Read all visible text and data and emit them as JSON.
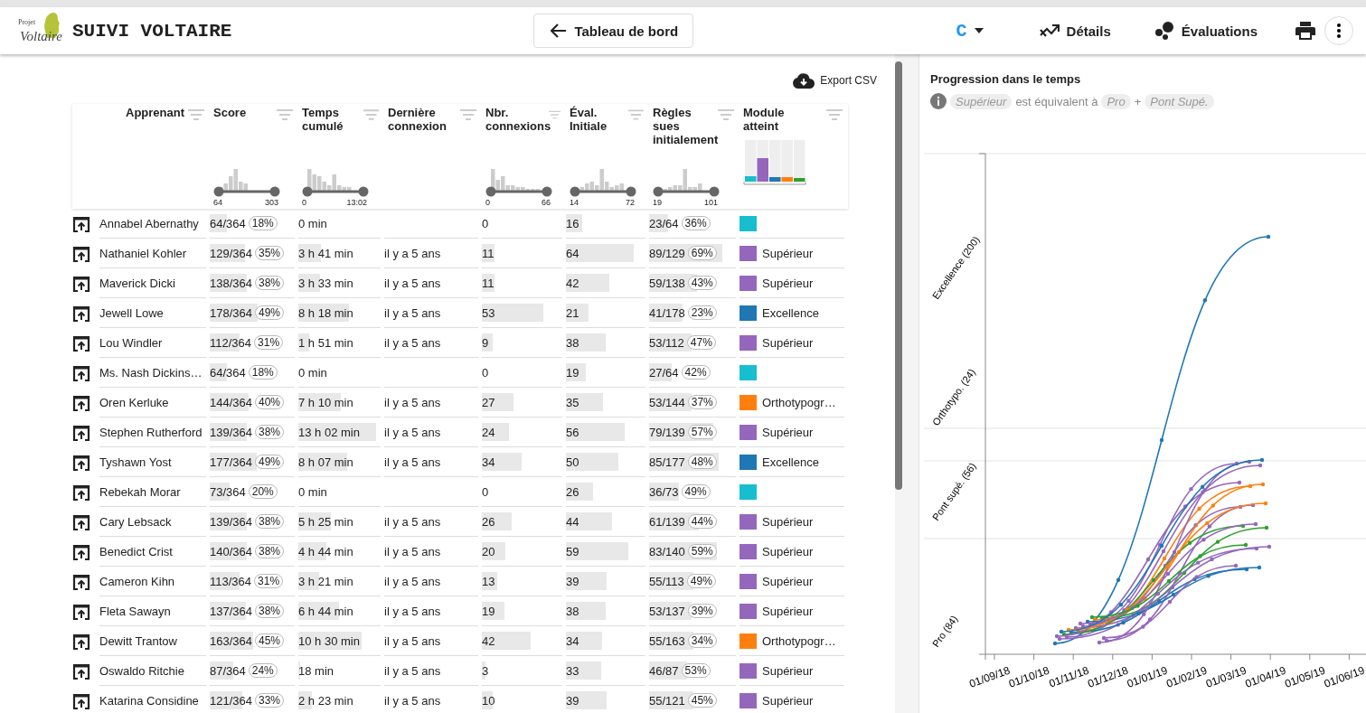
{
  "app_bar": {
    "logo_small": "Projet",
    "logo_script": "Voltaire",
    "title": "SUIVI VOLTAIRE",
    "back_button": "Tableau de bord",
    "level_menu": "C",
    "actions": [
      "Détails",
      "Évaluations"
    ]
  },
  "export_button": "Export CSV",
  "table": {
    "columns": [
      {
        "label": "Apprenant",
        "kind": "plain"
      },
      {
        "label": "Score",
        "kind": "histogram",
        "min": "64",
        "max": "303"
      },
      {
        "label": "Temps cumulé",
        "kind": "histogram",
        "min": "0",
        "max": "13:02"
      },
      {
        "label": "Dernière connexion",
        "kind": "plain"
      },
      {
        "label": "Nbr. connexions",
        "kind": "histogram",
        "min": "0",
        "max": "66"
      },
      {
        "label": "Éval. Initiale",
        "kind": "histogram",
        "min": "14",
        "max": "72"
      },
      {
        "label": "Règles sues initialement",
        "kind": "histogram",
        "min": "19",
        "max": "101"
      },
      {
        "label": "Module atteint",
        "kind": "modules"
      }
    ],
    "rows": [
      {
        "name": "Annabel Abernathy",
        "score": {
          "text": "64/364",
          "pct": "18%",
          "level": 0.21
        },
        "time": {
          "text": "0 min"
        },
        "conn": {
          "text": "0"
        },
        "eval": {
          "text": "16",
          "level": 0.22
        },
        "rules": {
          "text": "23/64",
          "pct": "36%",
          "level": 0.23
        },
        "module": {
          "color": "#17becf"
        }
      },
      {
        "name": "Nathaniel Kohler",
        "score": {
          "text": "129/364",
          "pct": "35%",
          "level": 0.43
        },
        "time": {
          "text": "3 h 41 min",
          "level": 0.28
        },
        "last": "il y a 5 ans",
        "conn": {
          "text": "11",
          "level": 0.17
        },
        "eval": {
          "text": "64",
          "level": 0.89
        },
        "rules": {
          "text": "89/129",
          "pct": "69%",
          "level": 0.88
        },
        "module": {
          "color": "#9467bd",
          "label": "Supérieur"
        }
      },
      {
        "name": "Maverick Dicki",
        "score": {
          "text": "138/364",
          "pct": "38%",
          "level": 0.46
        },
        "time": {
          "text": "3 h 33 min",
          "level": 0.27
        },
        "last": "il y a 5 ans",
        "conn": {
          "text": "11",
          "level": 0.17
        },
        "eval": {
          "text": "42",
          "level": 0.58
        },
        "rules": {
          "text": "59/138",
          "pct": "43%",
          "level": 0.58
        },
        "module": {
          "color": "#9467bd",
          "label": "Supérieur"
        }
      },
      {
        "name": "Jewell Lowe",
        "score": {
          "text": "178/364",
          "pct": "49%",
          "level": 0.59
        },
        "time": {
          "text": "8 h 18 min",
          "level": 0.64
        },
        "last": "il y a 5 ans",
        "conn": {
          "text": "53",
          "level": 0.8
        },
        "eval": {
          "text": "21",
          "level": 0.29
        },
        "rules": {
          "text": "41/178",
          "pct": "23%",
          "level": 0.41
        },
        "module": {
          "color": "#1f77b4",
          "label": "Excellence"
        }
      },
      {
        "name": "Lou Windler",
        "score": {
          "text": "112/364",
          "pct": "31%",
          "level": 0.37
        },
        "time": {
          "text": "1 h 51 min",
          "level": 0.14
        },
        "last": "il y a 5 ans",
        "conn": {
          "text": "9",
          "level": 0.14
        },
        "eval": {
          "text": "38",
          "level": 0.53
        },
        "rules": {
          "text": "53/112",
          "pct": "47%",
          "level": 0.52
        },
        "module": {
          "color": "#9467bd",
          "label": "Supérieur"
        }
      },
      {
        "name": "Ms. Nash Dickins…",
        "score": {
          "text": "64/364",
          "pct": "18%",
          "level": 0.21
        },
        "time": {
          "text": "0 min"
        },
        "conn": {
          "text": "0"
        },
        "eval": {
          "text": "19",
          "level": 0.26
        },
        "rules": {
          "text": "27/64",
          "pct": "42%",
          "level": 0.27
        },
        "module": {
          "color": "#17becf"
        }
      },
      {
        "name": "Oren Kerluke",
        "score": {
          "text": "144/364",
          "pct": "40%",
          "level": 0.48
        },
        "time": {
          "text": "7 h 10 min",
          "level": 0.55
        },
        "last": "il y a 5 ans",
        "conn": {
          "text": "27",
          "level": 0.41
        },
        "eval": {
          "text": "35",
          "level": 0.49
        },
        "rules": {
          "text": "53/144",
          "pct": "37%",
          "level": 0.52
        },
        "module": {
          "color": "#ff7f0e",
          "label": "Orthotypogr…"
        }
      },
      {
        "name": "Stephen Rutherford",
        "score": {
          "text": "139/364",
          "pct": "38%",
          "level": 0.46
        },
        "time": {
          "text": "13 h 02 min",
          "level": 1
        },
        "last": "il y a 5 ans",
        "conn": {
          "text": "24",
          "level": 0.36
        },
        "eval": {
          "text": "56",
          "level": 0.78
        },
        "rules": {
          "text": "79/139",
          "pct": "57%",
          "level": 0.78
        },
        "module": {
          "color": "#9467bd",
          "label": "Supérieur"
        }
      },
      {
        "name": "Tyshawn Yost",
        "score": {
          "text": "177/364",
          "pct": "49%",
          "level": 0.58
        },
        "time": {
          "text": "8 h 07 min",
          "level": 0.62
        },
        "last": "il y a 5 ans",
        "conn": {
          "text": "34",
          "level": 0.52
        },
        "eval": {
          "text": "50",
          "level": 0.69
        },
        "rules": {
          "text": "85/177",
          "pct": "48%",
          "level": 0.84
        },
        "module": {
          "color": "#1f77b4",
          "label": "Excellence"
        }
      },
      {
        "name": "Rebekah Morar",
        "score": {
          "text": "73/364",
          "pct": "20%",
          "level": 0.24
        },
        "time": {
          "text": "0 min"
        },
        "conn": {
          "text": "0"
        },
        "eval": {
          "text": "26",
          "level": 0.36
        },
        "rules": {
          "text": "36/73",
          "pct": "49%",
          "level": 0.36
        },
        "module": {
          "color": "#17becf"
        }
      },
      {
        "name": "Cary Lebsack",
        "score": {
          "text": "139/364",
          "pct": "38%",
          "level": 0.46
        },
        "time": {
          "text": "5 h 25 min",
          "level": 0.42
        },
        "last": "il y a 5 ans",
        "conn": {
          "text": "26",
          "level": 0.39
        },
        "eval": {
          "text": "44",
          "level": 0.61
        },
        "rules": {
          "text": "61/139",
          "pct": "44%",
          "level": 0.6
        },
        "module": {
          "color": "#9467bd",
          "label": "Supérieur"
        }
      },
      {
        "name": "Benedict Crist",
        "score": {
          "text": "140/364",
          "pct": "38%",
          "level": 0.46
        },
        "time": {
          "text": "4 h 44 min",
          "level": 0.36
        },
        "last": "il y a 5 ans",
        "conn": {
          "text": "20",
          "level": 0.3
        },
        "eval": {
          "text": "59",
          "level": 0.82
        },
        "rules": {
          "text": "83/140",
          "pct": "59%",
          "level": 0.82
        },
        "module": {
          "color": "#9467bd",
          "label": "Supérieur"
        }
      },
      {
        "name": "Cameron Kihn",
        "score": {
          "text": "113/364",
          "pct": "31%",
          "level": 0.37
        },
        "time": {
          "text": "3 h 21 min",
          "level": 0.26
        },
        "last": "il y a 5 ans",
        "conn": {
          "text": "13",
          "level": 0.2
        },
        "eval": {
          "text": "39",
          "level": 0.54
        },
        "rules": {
          "text": "55/113",
          "pct": "49%",
          "level": 0.54
        },
        "module": {
          "color": "#9467bd",
          "label": "Supérieur"
        }
      },
      {
        "name": "Fleta Sawayn",
        "score": {
          "text": "137/364",
          "pct": "38%",
          "level": 0.45
        },
        "time": {
          "text": "6 h 44 min",
          "level": 0.52
        },
        "last": "il y a 5 ans",
        "conn": {
          "text": "19",
          "level": 0.29
        },
        "eval": {
          "text": "38",
          "level": 0.53
        },
        "rules": {
          "text": "53/137",
          "pct": "39%",
          "level": 0.52
        },
        "module": {
          "color": "#9467bd",
          "label": "Supérieur"
        }
      },
      {
        "name": "Dewitt Trantow",
        "score": {
          "text": "163/364",
          "pct": "45%",
          "level": 0.54
        },
        "time": {
          "text": "10 h 30 min",
          "level": 0.81
        },
        "last": "il y a 5 ans",
        "conn": {
          "text": "42",
          "level": 0.64
        },
        "eval": {
          "text": "34",
          "level": 0.47
        },
        "rules": {
          "text": "55/163",
          "pct": "34%",
          "level": 0.54
        },
        "module": {
          "color": "#ff7f0e",
          "label": "Orthotypogr…"
        }
      },
      {
        "name": "Oswaldo Ritchie",
        "score": {
          "text": "87/364",
          "pct": "24%",
          "level": 0.29
        },
        "time": {
          "text": "18 min",
          "level": 0.02
        },
        "last": "il y a 5 ans",
        "conn": {
          "text": "3",
          "level": 0.05
        },
        "eval": {
          "text": "33",
          "level": 0.46
        },
        "rules": {
          "text": "46/87",
          "pct": "53%",
          "level": 0.46
        },
        "module": {
          "color": "#9467bd",
          "label": "Supérieur"
        }
      },
      {
        "name": "Katarina Considine",
        "score": {
          "text": "121/364",
          "pct": "33%",
          "level": 0.4
        },
        "time": {
          "text": "2 h 23 min",
          "level": 0.18
        },
        "last": "il y a 5 ans",
        "conn": {
          "text": "10",
          "level": 0.15
        },
        "eval": {
          "text": "39",
          "level": 0.54
        },
        "rules": {
          "text": "55/121",
          "pct": "45%",
          "level": 0.54
        },
        "module": {
          "color": "#9467bd",
          "label": "Supérieur"
        }
      }
    ]
  },
  "chart": {
    "title": "Progression dans le temps",
    "note": [
      {
        "kind": "chip",
        "text": "Supérieur"
      },
      {
        "kind": "text",
        "text": "est équivalent à"
      },
      {
        "kind": "chip",
        "text": "Pro"
      },
      {
        "kind": "text",
        "text": "+"
      },
      {
        "kind": "chip",
        "text": "Pont Supé."
      }
    ],
    "y_labels": [
      "Excellence (200)",
      "Orthotypo. (24)",
      "Pont supé. (56)",
      "Pro (84)"
    ],
    "x_labels": [
      "01/09/18",
      "01/10/18",
      "01/11/18",
      "01/12/18",
      "01/01/19",
      "01/02/19",
      "01/03/19",
      "01/04/19",
      "01/05/19",
      "01/06/19"
    ]
  }
}
